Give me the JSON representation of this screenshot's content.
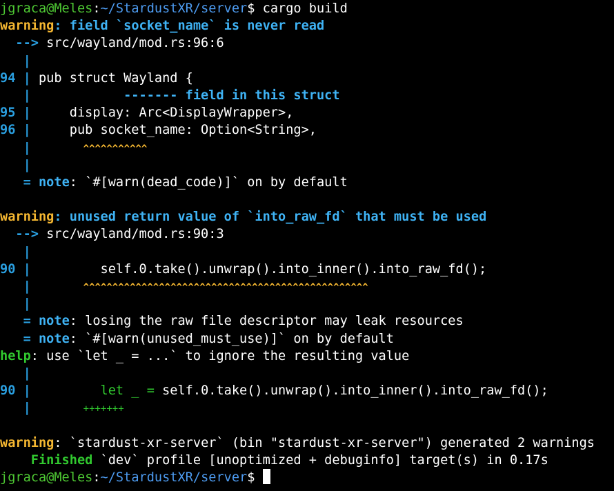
{
  "colors": {
    "background": "#000000",
    "text": "#ffffff",
    "prompt_green": "#4ec833",
    "path_blue": "#4d9bf0",
    "gutter_blue": "#2a9fe0",
    "warning_yellow": "#f5b731",
    "message_blue": "#3fb3f5",
    "help_green": "#31c92f",
    "note_blue": "#3fb3f5",
    "cursor": "#ffffff"
  },
  "lines": [
    [
      {
        "text": "jgraca@Meles",
        "color": "prompt_green",
        "name": "prompt-user-host"
      },
      {
        "text": ":",
        "color": "text",
        "name": "prompt-separator"
      },
      {
        "text": "~/StardustXR/server",
        "color": "path_blue",
        "name": "prompt-path"
      },
      {
        "text": "$ cargo build",
        "color": "text",
        "name": "command-text"
      }
    ],
    [
      {
        "text": "warning",
        "color": "warning_yellow",
        "bold": true,
        "name": "warning-label"
      },
      {
        "text": ": field `socket_name` is never read",
        "color": "message_blue",
        "bold": true,
        "name": "warning-message"
      }
    ],
    [
      {
        "text": "  --> ",
        "color": "gutter_blue",
        "bold": true,
        "name": "location-arrow"
      },
      {
        "text": "src/wayland/mod.rs:96:6",
        "color": "text",
        "name": "source-location"
      }
    ],
    [
      {
        "text": "   |",
        "color": "gutter_blue",
        "bold": true,
        "name": "gutter-bar"
      }
    ],
    [
      {
        "text": "94 |",
        "color": "gutter_blue",
        "bold": true,
        "name": "line-number-gutter"
      },
      {
        "text": " pub struct Wayland {",
        "color": "text",
        "name": "code-text"
      }
    ],
    [
      {
        "text": "   |",
        "color": "gutter_blue",
        "bold": true,
        "name": "gutter-bar"
      },
      {
        "text": "            ------- field in this struct",
        "color": "message_blue",
        "bold": true,
        "name": "code-annotation"
      }
    ],
    [
      {
        "text": "95 |",
        "color": "gutter_blue",
        "bold": true,
        "name": "line-number-gutter"
      },
      {
        "text": "     display: Arc<DisplayWrapper>,",
        "color": "text",
        "name": "code-text"
      }
    ],
    [
      {
        "text": "96 |",
        "color": "gutter_blue",
        "bold": true,
        "name": "line-number-gutter"
      },
      {
        "text": "     pub socket_name: Option<String>,",
        "color": "text",
        "name": "code-text"
      }
    ],
    [
      {
        "text": "   |",
        "color": "gutter_blue",
        "bold": true,
        "name": "gutter-bar"
      },
      {
        "text": "         ^^^^^^^^^^^",
        "color": "warning_yellow",
        "bold": true,
        "small": true,
        "name": "error-underline"
      }
    ],
    [
      {
        "text": "   |",
        "color": "gutter_blue",
        "bold": true,
        "name": "gutter-bar"
      }
    ],
    [
      {
        "text": "   = ",
        "color": "gutter_blue",
        "bold": true,
        "name": "note-equals"
      },
      {
        "text": "note",
        "color": "note_blue",
        "bold": true,
        "name": "note-label"
      },
      {
        "text": ": `#[warn(dead_code)]` on by default",
        "color": "text",
        "name": "note-message"
      }
    ],
    [],
    [
      {
        "text": "warning",
        "color": "warning_yellow",
        "bold": true,
        "name": "warning-label"
      },
      {
        "text": ": unused return value of `into_raw_fd` that must be used",
        "color": "message_blue",
        "bold": true,
        "name": "warning-message"
      }
    ],
    [
      {
        "text": "  --> ",
        "color": "gutter_blue",
        "bold": true,
        "name": "location-arrow"
      },
      {
        "text": "src/wayland/mod.rs:90:3",
        "color": "text",
        "name": "source-location"
      }
    ],
    [
      {
        "text": "   |",
        "color": "gutter_blue",
        "bold": true,
        "name": "gutter-bar"
      }
    ],
    [
      {
        "text": "90 |",
        "color": "gutter_blue",
        "bold": true,
        "name": "line-number-gutter"
      },
      {
        "text": "         self.0.take().unwrap().into_inner().into_raw_fd();",
        "color": "text",
        "name": "code-text"
      }
    ],
    [
      {
        "text": "   |",
        "color": "gutter_blue",
        "bold": true,
        "name": "gutter-bar"
      },
      {
        "text": "         ^^^^^^^^^^^^^^^^^^^^^^^^^^^^^^^^^^^^^^^^^^^^^^^^^",
        "color": "warning_yellow",
        "bold": true,
        "small": true,
        "name": "error-underline"
      }
    ],
    [
      {
        "text": "   |",
        "color": "gutter_blue",
        "bold": true,
        "name": "gutter-bar"
      }
    ],
    [
      {
        "text": "   = ",
        "color": "gutter_blue",
        "bold": true,
        "name": "note-equals"
      },
      {
        "text": "note",
        "color": "note_blue",
        "bold": true,
        "name": "note-label"
      },
      {
        "text": ": losing the raw file descriptor may leak resources",
        "color": "text",
        "name": "note-message"
      }
    ],
    [
      {
        "text": "   = ",
        "color": "gutter_blue",
        "bold": true,
        "name": "note-equals"
      },
      {
        "text": "note",
        "color": "note_blue",
        "bold": true,
        "name": "note-label"
      },
      {
        "text": ": `#[warn(unused_must_use)]` on by default",
        "color": "text",
        "name": "note-message"
      }
    ],
    [
      {
        "text": "help",
        "color": "help_green",
        "bold": true,
        "name": "help-label"
      },
      {
        "text": ": use `let _ = ...` to ignore the resulting value",
        "color": "text",
        "name": "help-message"
      }
    ],
    [
      {
        "text": "   |",
        "color": "gutter_blue",
        "bold": true,
        "name": "gutter-bar"
      }
    ],
    [
      {
        "text": "90 |",
        "color": "gutter_blue",
        "bold": true,
        "name": "line-number-gutter"
      },
      {
        "text": "         ",
        "color": "text",
        "name": "code-indent"
      },
      {
        "text": "let _ = ",
        "color": "help_green",
        "name": "suggestion-insert"
      },
      {
        "text": "self.0.take().unwrap().into_inner().into_raw_fd();",
        "color": "text",
        "name": "code-text"
      }
    ],
    [
      {
        "text": "   |",
        "color": "gutter_blue",
        "bold": true,
        "name": "gutter-bar"
      },
      {
        "text": "         +++++++",
        "color": "help_green",
        "small": true,
        "name": "suggestion-marker"
      }
    ],
    [],
    [
      {
        "text": "warning",
        "color": "warning_yellow",
        "bold": true,
        "name": "warning-label"
      },
      {
        "text": ": `stardust-xr-server` (bin \"stardust-xr-server\") generated 2 warnings",
        "color": "text",
        "name": "warning-summary"
      }
    ],
    [
      {
        "text": "    Finished",
        "color": "help_green",
        "bold": true,
        "name": "finished-label"
      },
      {
        "text": " `dev` profile [unoptimized + debuginfo] target(s) in 0.17s",
        "color": "text",
        "name": "build-summary"
      }
    ],
    [
      {
        "text": "jgraca@Meles",
        "color": "prompt_green",
        "name": "prompt-user-host"
      },
      {
        "text": ":",
        "color": "text",
        "name": "prompt-separator"
      },
      {
        "text": "~/StardustXR/server",
        "color": "path_blue",
        "name": "prompt-path"
      },
      {
        "text": "$ ",
        "color": "text",
        "name": "prompt-symbol"
      },
      {
        "text": "",
        "cursor": true,
        "name": "terminal-cursor"
      }
    ]
  ]
}
